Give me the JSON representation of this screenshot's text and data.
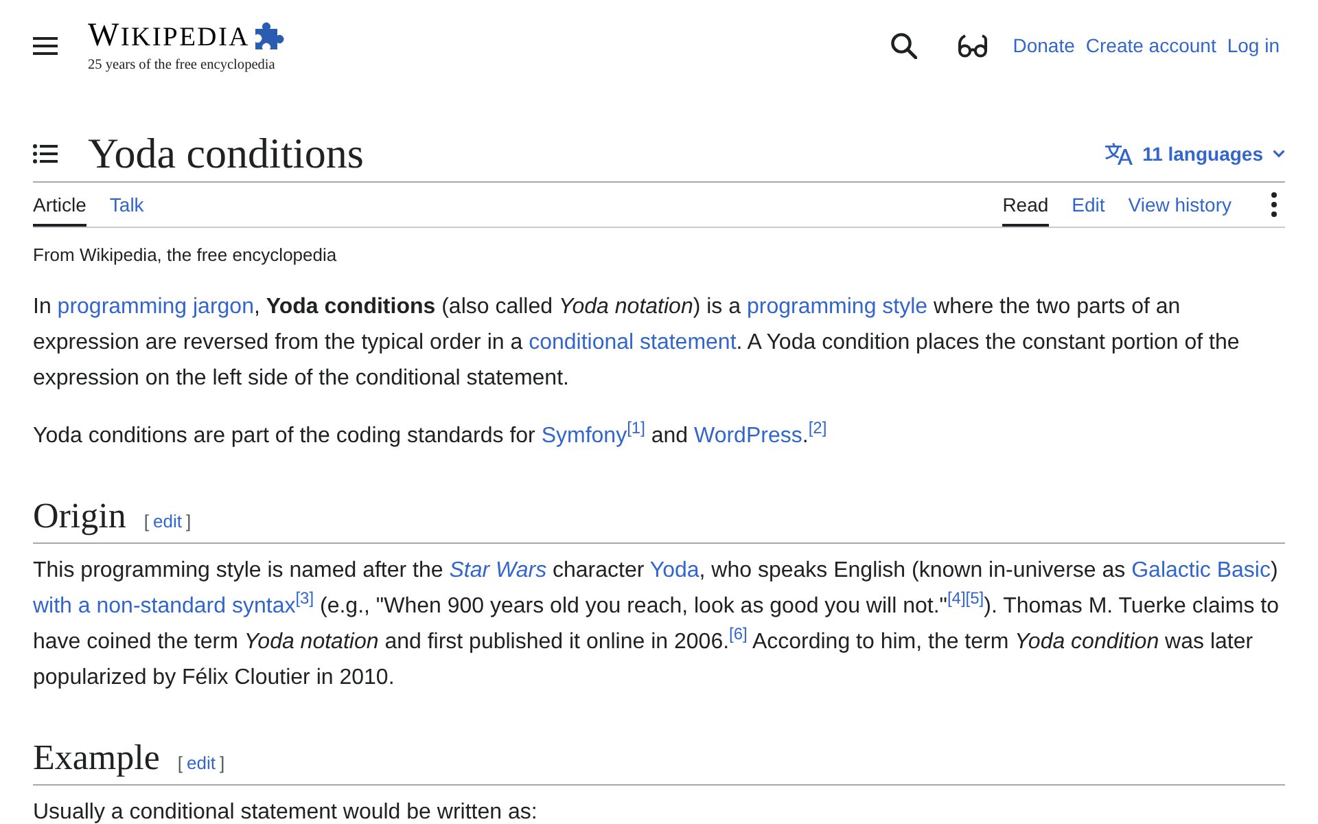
{
  "header": {
    "wordmark": "WIKIPEDIA",
    "tagline": "25 years of the free encyclopedia",
    "links": [
      "Donate",
      "Create account",
      "Log in"
    ]
  },
  "title_bar": {
    "title": "Yoda conditions",
    "languages": "11 languages"
  },
  "namespace_tabs": [
    {
      "label": "Article",
      "selected": true
    },
    {
      "label": "Talk",
      "selected": false
    }
  ],
  "view_tabs": [
    {
      "label": "Read",
      "selected": true
    },
    {
      "label": "Edit",
      "selected": false
    },
    {
      "label": "View history",
      "selected": false
    }
  ],
  "site_sub": "From Wikipedia, the free encyclopedia",
  "content": [
    {
      "kind": "paragraph",
      "runs": [
        {
          "kind": "text",
          "text": "In "
        },
        {
          "kind": "link",
          "text": "programming jargon"
        },
        {
          "kind": "text",
          "text": ", **Yoda conditions** (also called *Yoda notation*) is a "
        },
        {
          "kind": "link",
          "text": "programming style"
        },
        {
          "kind": "text",
          "text": " where the two parts of an expression are reversed from the typical order in a "
        },
        {
          "kind": "link",
          "text": "conditional statement"
        },
        {
          "kind": "text",
          "text": ". A Yoda condition places the constant portion of the expression on the left side of the conditional statement."
        }
      ]
    },
    {
      "kind": "paragraph",
      "runs": [
        {
          "kind": "text",
          "text": "Yoda conditions are part of the coding standards for "
        },
        {
          "kind": "link",
          "text": "Symfony"
        },
        {
          "kind": "ref",
          "text": "[1]"
        },
        {
          "kind": "text",
          "text": " and "
        },
        {
          "kind": "link",
          "text": "WordPress",
          "after": "."
        },
        {
          "kind": "ref",
          "text": "[2]"
        }
      ]
    },
    {
      "kind": "heading",
      "text": "Origin",
      "edit": {
        "open": "[",
        "label": "edit",
        "close": "]"
      }
    },
    {
      "kind": "paragraph",
      "runs": [
        {
          "kind": "text",
          "text": "This programming style is named after the "
        },
        {
          "kind": "link",
          "text": "*Star Wars*"
        },
        {
          "kind": "text",
          "text": " character "
        },
        {
          "kind": "link",
          "text": "Yoda"
        },
        {
          "kind": "text",
          "text": ", who speaks English (known in-universe as "
        },
        {
          "kind": "link",
          "text": "Galactic Basic"
        },
        {
          "kind": "text",
          "text": ") "
        },
        {
          "kind": "link",
          "text": "with a non-standard syntax"
        },
        {
          "kind": "ref",
          "text": "[3]"
        },
        {
          "kind": "text",
          "text": " (e.g., \"When 900 years old you reach, look as good you will not.\""
        },
        {
          "kind": "ref",
          "text": "[4]"
        },
        {
          "kind": "ref",
          "text": "[5]"
        },
        {
          "kind": "text",
          "text": "). Thomas M. Tuerke claims to have coined the term *Yoda notation* and first published it online in 2006."
        },
        {
          "kind": "ref",
          "text": "[6]"
        },
        {
          "kind": "text",
          "text": " According to him, the term *Yoda condition* was later popularized by Félix Cloutier in 2010."
        }
      ]
    },
    {
      "kind": "heading",
      "text": "Example",
      "edit": {
        "open": "[",
        "label": "edit",
        "close": "]"
      }
    },
    {
      "kind": "paragraph",
      "runs": [
        {
          "kind": "text",
          "text": "Usually a conditional statement would be written as:"
        }
      ]
    }
  ]
}
